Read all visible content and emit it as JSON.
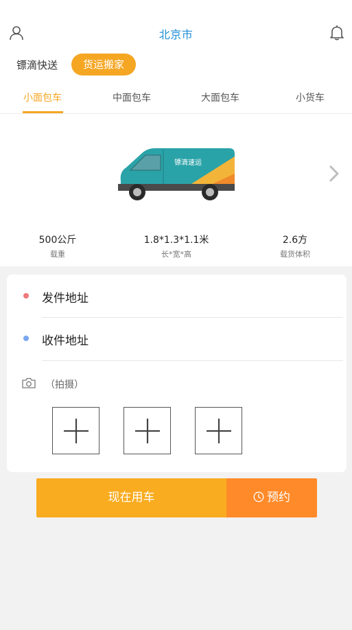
{
  "header": {
    "city": "北京市",
    "user_icon": "user-icon",
    "bell_icon": "bell-icon"
  },
  "modes": [
    {
      "label": "镖滴快送",
      "active": false
    },
    {
      "label": "货运搬家",
      "active": true
    }
  ],
  "tabs": [
    {
      "label": "小面包车",
      "active": true
    },
    {
      "label": "中面包车",
      "active": false
    },
    {
      "label": "大面包车",
      "active": false
    },
    {
      "label": "小货车",
      "active": false
    }
  ],
  "vehicle": {
    "brand_text": "镖滴速运",
    "specs": [
      {
        "value": "500公斤",
        "label": "载重"
      },
      {
        "value": "1.8*1.3*1.1米",
        "label": "长*宽*高"
      },
      {
        "value": "2.6方",
        "label": "载货体积"
      }
    ]
  },
  "form": {
    "sender_label": "发件地址",
    "receiver_label": "收件地址",
    "photo_label": "（拍摄）",
    "sender_dot_color": "#f07a7a",
    "receiver_dot_color": "#7aa7f0"
  },
  "actions": {
    "now_label": "现在用车",
    "book_label": "预约"
  },
  "colors": {
    "accent": "#f5a623",
    "city": "#1e90d8",
    "book": "#ff8a2a"
  }
}
